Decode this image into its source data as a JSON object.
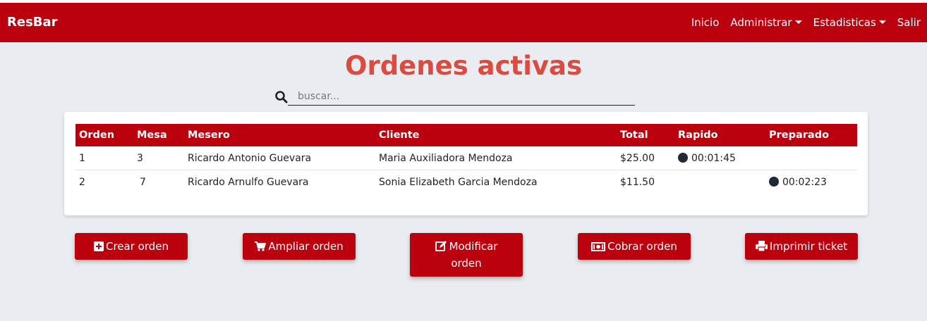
{
  "navbar": {
    "brand": "ResBar",
    "links": {
      "inicio": "Inicio",
      "administrar": "Administrar",
      "estadisticas": "Estadisticas",
      "salir": "Salir"
    }
  },
  "page": {
    "title": "Ordenes activas"
  },
  "search": {
    "placeholder": "buscar..."
  },
  "table": {
    "headers": [
      "Orden",
      "Mesa",
      "Mesero",
      "Cliente",
      "Total",
      "Rapido",
      "Preparado"
    ],
    "rows": [
      {
        "orden": "1",
        "mesa": "3",
        "mesero": "Ricardo Antonio Guevara",
        "cliente": "Maria Auxiliadora Mendoza",
        "total": "$25.00",
        "rapido": "00:01:45",
        "preparado": ""
      },
      {
        "orden": "2",
        "mesa": "7",
        "mesero": "Ricardo Arnulfo Guevara",
        "cliente": "Sonia Elizabeth Garcia Mendoza",
        "total": "$11.50",
        "rapido": "",
        "preparado": "00:02:23"
      }
    ]
  },
  "actions": {
    "crear": "Crear orden",
    "ampliar": "Ampliar orden",
    "modificar_line1": "Modificar",
    "modificar_line2": "orden",
    "cobrar": "Cobrar orden",
    "imprimir": "Imprimir ticket"
  },
  "colors": {
    "brand": "#bb000e",
    "title": "#dc4b3f",
    "background": "#e9edf1",
    "timer_dot": "#1f2a36"
  },
  "icons": [
    "search-icon",
    "plus-square-icon",
    "cart-icon",
    "edit-icon",
    "money-bill-icon",
    "print-icon",
    "clock-dot-icon"
  ]
}
